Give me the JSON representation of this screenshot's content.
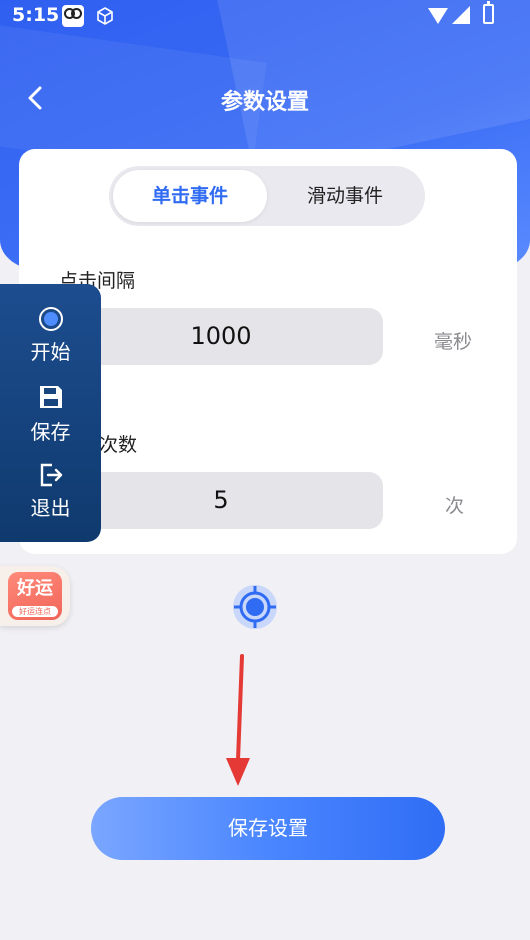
{
  "status_bar": {
    "time": "5:15"
  },
  "header": {
    "title": "参数设置"
  },
  "tabs": [
    {
      "label": "单击事件",
      "active": true
    },
    {
      "label": "滑动事件",
      "active": false
    }
  ],
  "fields": {
    "interval": {
      "label": "点击间隔",
      "value": "1000",
      "unit": "毫秒"
    },
    "count": {
      "label": "次数",
      "value": "5",
      "unit": "次"
    }
  },
  "float_menu": {
    "start": "开始",
    "save": "保存",
    "exit": "退出"
  },
  "app_badge": {
    "big": "好运",
    "small": "好运连点"
  },
  "save_button": {
    "label": "保存设置"
  },
  "colors": {
    "accent": "#2f6bf3",
    "header_bg": "#3a6cf5",
    "arrow": "#e53935"
  }
}
